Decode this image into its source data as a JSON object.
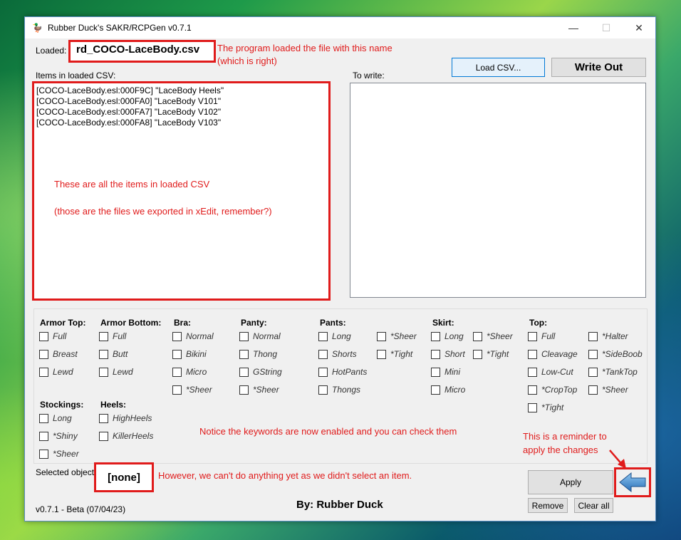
{
  "window": {
    "title": "Rubber Duck's SAKR/RCPGen v0.7.1",
    "minimize": "—",
    "maximize": "☐",
    "close": "✕"
  },
  "loaded": {
    "label": "Loaded:",
    "filename": "rd_COCO-LaceBody.csv",
    "note_line1": "The program loaded the file with this name",
    "note_line2": "(which is right)"
  },
  "items_list": {
    "label": "Items in loaded CSV:",
    "items": [
      "[COCO-LaceBody.esl:000F9C] \"LaceBody Heels\"",
      "[COCO-LaceBody.esl:000FA0] \"LaceBody V101\"",
      "[COCO-LaceBody.esl:000FA7] \"LaceBody V102\"",
      "[COCO-LaceBody.esl:000FA8] \"LaceBody V103\""
    ],
    "note_line1": "These are all the items in loaded CSV",
    "note_line2": "(those are the files we exported in xEdit, remember?)"
  },
  "to_write": {
    "label": "To write:"
  },
  "buttons": {
    "load_csv": "Load CSV...",
    "write_out": "Write Out",
    "apply": "Apply",
    "remove": "Remove",
    "clear_all": "Clear all"
  },
  "keywords": {
    "armor_top": {
      "title": "Armor Top:",
      "items": [
        "Full",
        "Breast",
        "Lewd"
      ]
    },
    "armor_bottom": {
      "title": "Armor Bottom:",
      "items": [
        "Full",
        "Butt",
        "Lewd"
      ]
    },
    "bra": {
      "title": "Bra:",
      "items": [
        "Normal",
        "Bikini",
        "Micro",
        "*Sheer"
      ]
    },
    "panty": {
      "title": "Panty:",
      "items": [
        "Normal",
        "Thong",
        "GString",
        "*Sheer"
      ]
    },
    "pants": {
      "title": "Pants:",
      "items": [
        "Long",
        "Shorts",
        "HotPants",
        "Thongs"
      ],
      "items2": [
        "*Sheer",
        "*Tight"
      ]
    },
    "skirt": {
      "title": "Skirt:",
      "items": [
        "Long",
        "Short",
        "Mini",
        "Micro"
      ],
      "items2": [
        "*Sheer",
        "*Tight"
      ]
    },
    "top": {
      "title": "Top:",
      "items": [
        "Full",
        "Cleavage",
        "Low-Cut",
        "*CropTop",
        "*Tight"
      ],
      "items2": [
        "*Halter",
        "*SideBoob",
        "*TankTop",
        "*Sheer"
      ]
    },
    "stockings": {
      "title": "Stockings:",
      "items": [
        "Long",
        "*Shiny",
        "*Sheer"
      ]
    },
    "heels": {
      "title": "Heels:",
      "items": [
        "HighHeels",
        "KillerHeels"
      ]
    },
    "note": "Notice the keywords are now enabled and you can check them"
  },
  "selected": {
    "label": "Selected object:",
    "value": "[none]",
    "note": "However, we can't do anything yet as we didn't select an item."
  },
  "reminder": {
    "line1": "This is a reminder to",
    "line2": "apply the changes"
  },
  "footer": {
    "version": "v0.7.1 - Beta (07/04/23)",
    "author": "By: Rubber Duck"
  },
  "colors": {
    "annotation": "#e01b1b",
    "accent": "#0078d7"
  }
}
